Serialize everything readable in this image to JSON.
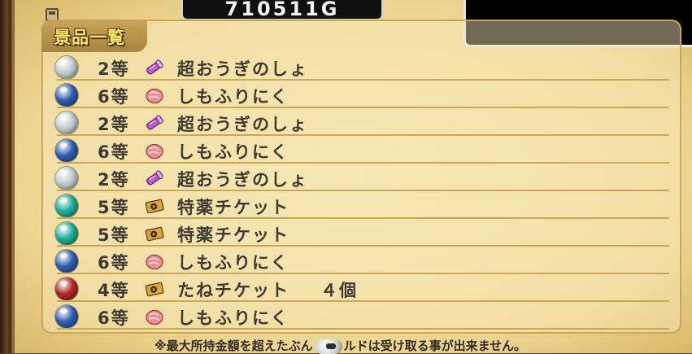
{
  "gold_display": "710511G",
  "header": {
    "title": "景品一覧"
  },
  "colors": {
    "silver": "#c4cfd3",
    "blue": "#2f5fb3",
    "teal": "#1fb09a",
    "red": "#b3262a"
  },
  "prizes": [
    {
      "orb": "silver",
      "rank": "2等",
      "icon": "scroll-icon",
      "name": "超おうぎのしょ",
      "qty": ""
    },
    {
      "orb": "blue",
      "rank": "6等",
      "icon": "meat-icon",
      "name": "しもふりにく",
      "qty": ""
    },
    {
      "orb": "silver",
      "rank": "2等",
      "icon": "scroll-icon",
      "name": "超おうぎのしょ",
      "qty": ""
    },
    {
      "orb": "blue",
      "rank": "6等",
      "icon": "meat-icon",
      "name": "しもふりにく",
      "qty": ""
    },
    {
      "orb": "silver",
      "rank": "2等",
      "icon": "scroll-icon",
      "name": "超おうぎのしょ",
      "qty": ""
    },
    {
      "orb": "teal",
      "rank": "5等",
      "icon": "ticket-icon",
      "name": "特薬チケット",
      "qty": ""
    },
    {
      "orb": "teal",
      "rank": "5等",
      "icon": "ticket-icon",
      "name": "特薬チケット",
      "qty": ""
    },
    {
      "orb": "blue",
      "rank": "6等",
      "icon": "meat-icon",
      "name": "しもふりにく",
      "qty": ""
    },
    {
      "orb": "red",
      "rank": "4等",
      "icon": "ticket-icon",
      "name": "たねチケット",
      "qty": "４個"
    },
    {
      "orb": "blue",
      "rank": "6等",
      "icon": "meat-icon",
      "name": "しもふりにく",
      "qty": ""
    }
  ],
  "footer": {
    "text_before": "※最大所持金額を超えたぶん",
    "badge_icon": "gold-coin-icon",
    "text_after": "ルドは受け取る事が出来ません。"
  }
}
